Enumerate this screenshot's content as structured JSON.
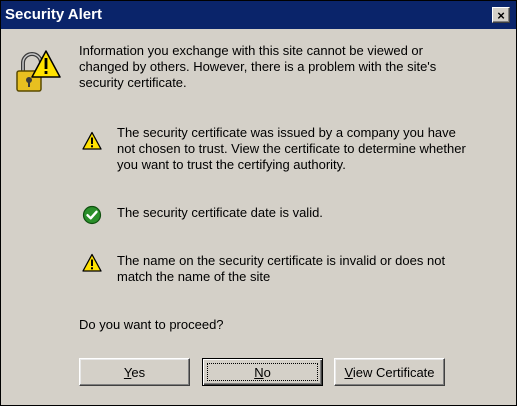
{
  "window": {
    "title": "Security Alert",
    "close_glyph": "×"
  },
  "intro": {
    "line1": "Information you exchange with this site cannot be viewed or",
    "line2": "changed by others. However, there is a problem with the site's",
    "line3": "security certificate."
  },
  "issues": [
    {
      "icon": "warning-icon",
      "lines": [
        "The security certificate was issued by a company you have",
        "not chosen to trust. View the certificate to determine whether",
        "you want to trust the certifying authority."
      ]
    },
    {
      "icon": "check-icon",
      "lines": [
        "The security certificate date is valid."
      ]
    },
    {
      "icon": "warning-icon",
      "lines": [
        "The name on the security certificate is invalid or does not",
        "match the name of the site"
      ]
    }
  ],
  "question": "Do you want to proceed?",
  "buttons": {
    "yes": {
      "mnemonic": "Y",
      "rest": "es"
    },
    "no": {
      "mnemonic": "N",
      "rest": "o"
    },
    "view": {
      "mnemonic": "V",
      "rest": "iew Certificate"
    }
  },
  "colors": {
    "titlebar": "#0a246a",
    "dialog_bg": "#d4d0c8",
    "warning_yellow": "#ffe100",
    "check_green": "#2a8f2a"
  }
}
